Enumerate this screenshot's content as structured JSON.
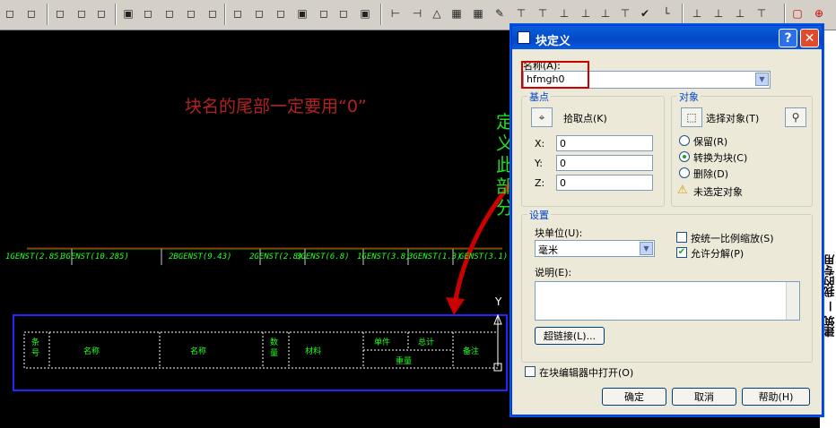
{
  "annotation": {
    "text": "块名的尾部一定要用“0”",
    "vertical_text": [
      "定",
      "义",
      "此",
      "部",
      "分"
    ]
  },
  "cad": {
    "strip_labels": [
      "1GENST(2.85)",
      "3GENST(10.285)",
      "2BGENST(9.43)",
      "2GENST(2.8)",
      "3GENST(6.8)",
      "1GENST(3.8)",
      "3GENST(1.3)",
      "GENST(3.1)"
    ],
    "table_cells": [
      "条号",
      "名称",
      "名称",
      "数量",
      "材料",
      "单件",
      "总计",
      "重量",
      "备注"
    ],
    "axis_label": "Y"
  },
  "right_panel": {
    "text": "建筑 — 我的专用"
  },
  "dialog": {
    "title": "块定义",
    "help_button": "?",
    "close_button": "✕",
    "name_label": "名称(A):",
    "name_value": "hfmgh0",
    "basepoint": {
      "title": "基点",
      "pick_label": "拾取点(K)",
      "x_label": "X:",
      "y_label": "Y:",
      "z_label": "Z:",
      "x": "0",
      "y": "0",
      "z": "0"
    },
    "objects": {
      "title": "对象",
      "select_label": "选择对象(T)",
      "retain": "保留(R)",
      "convert": "转换为块(C)",
      "delete": "删除(D)",
      "warning": "未选定对象",
      "selected_mode": "convert"
    },
    "settings": {
      "title": "设置",
      "unit_label": "块单位(U):",
      "unit_value": "毫米",
      "scale_uniform": "按统一比例缩放(S)",
      "scale_uniform_checked": false,
      "allow_explode": "允许分解(P)",
      "allow_explode_checked": true,
      "description_label": "说明(E):",
      "description": "",
      "hyperlink": "超链接(L)..."
    },
    "open_in_editor": "在块编辑器中打开(O)",
    "open_in_editor_checked": false,
    "ok": "确定",
    "cancel": "取消",
    "help": "帮助(H)"
  }
}
